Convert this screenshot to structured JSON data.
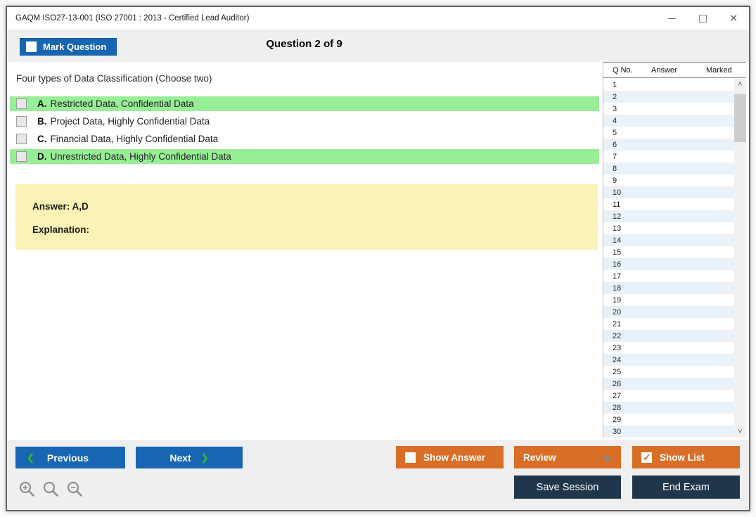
{
  "window": {
    "title": "GAQM ISO27-13-001 (ISO 27001 : 2013 - Certified Lead Auditor)"
  },
  "header": {
    "mark_question_label": "Mark Question",
    "question_counter": "Question 2 of 9"
  },
  "question": {
    "text": "Four types of Data Classification (Choose two)",
    "options": [
      {
        "letter": "A.",
        "text": "Restricted Data, Confidential Data",
        "highlighted": true,
        "checked": false
      },
      {
        "letter": "B.",
        "text": "Project Data, Highly Confidential Data",
        "highlighted": false,
        "checked": false
      },
      {
        "letter": "C.",
        "text": "Financial Data, Highly Confidential Data",
        "highlighted": false,
        "checked": false
      },
      {
        "letter": "D.",
        "text": "Unrestricted Data, Highly Confidential Data",
        "highlighted": true,
        "checked": false
      }
    ],
    "answer_label": "Answer: A,D",
    "explanation_label": "Explanation:"
  },
  "question_list": {
    "columns": {
      "qno": "Q No.",
      "answer": "Answer",
      "marked": "Marked"
    },
    "rows": [
      "1",
      "2",
      "3",
      "4",
      "5",
      "6",
      "7",
      "8",
      "9",
      "10",
      "11",
      "12",
      "13",
      "14",
      "15",
      "16",
      "17",
      "18",
      "19",
      "20",
      "21",
      "22",
      "23",
      "24",
      "25",
      "26",
      "27",
      "28",
      "29",
      "30"
    ]
  },
  "footer": {
    "previous_label": "Previous",
    "next_label": "Next",
    "show_answer_label": "Show Answer",
    "review_label": "Review",
    "show_list_label": "Show List",
    "save_session_label": "Save Session",
    "end_exam_label": "End Exam",
    "show_answer_checked": false,
    "show_list_checked": true
  },
  "icons": {
    "prev_chevron": "❮",
    "next_chevron": "❯",
    "scroll_up": "˄",
    "scroll_down": "˅",
    "close_glyph": "✕"
  },
  "colors": {
    "accent_blue": "#1866b2",
    "accent_orange": "#d96f26",
    "accent_navy": "#20374b",
    "highlight_green": "#98ee97",
    "answer_yellow": "#fbf2b7",
    "row_stripe_blue": "#eaf2f9",
    "chevron_green": "#2fb52f"
  }
}
